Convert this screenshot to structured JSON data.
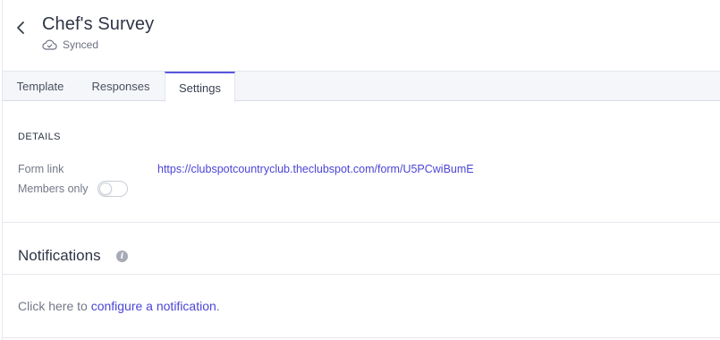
{
  "header": {
    "title": "Chef's Survey",
    "sync_status": "Synced",
    "back_icon": "chevron-left-icon",
    "sync_icon": "cloud-check-icon"
  },
  "tabs": [
    {
      "label": "Template",
      "active": false
    },
    {
      "label": "Responses",
      "active": false
    },
    {
      "label": "Settings",
      "active": true
    }
  ],
  "details": {
    "section_label": "DETAILS",
    "form_link_label": "Form link",
    "form_link_url": "https://clubspotcountryclub.theclubspot.com/form/U5PCwiBumE",
    "members_only_label": "Members only",
    "members_only_enabled": false
  },
  "notifications": {
    "title": "Notifications",
    "info_icon": "info-icon",
    "prefix": "Click here to ",
    "link_text": "configure a notification",
    "suffix": "."
  },
  "colors": {
    "accent": "#5a56e0",
    "link": "#4b45d6",
    "tab_bar_bg": "#f4f6f9"
  }
}
